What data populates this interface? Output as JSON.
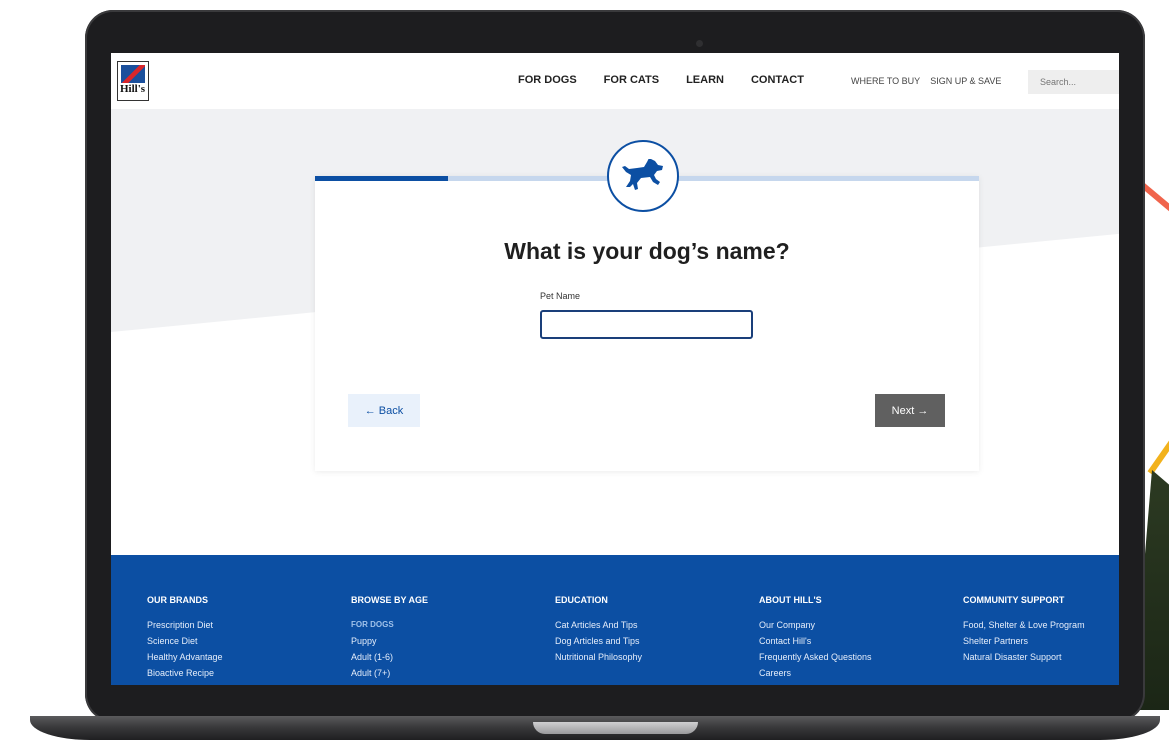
{
  "nav": {
    "logo_text": "Hill's",
    "main": [
      "FOR DOGS",
      "FOR CATS",
      "LEARN",
      "CONTACT"
    ],
    "secondary": [
      "WHERE TO BUY",
      "SIGN UP & SAVE"
    ],
    "search_placeholder": "Search..."
  },
  "quiz": {
    "progress": 0.2,
    "question": "What is your dog’s name?",
    "field_label": "Pet Name",
    "field_value": "",
    "back_label": "← Back",
    "next_label": "Next →"
  },
  "footer": {
    "columns": [
      {
        "heading": "OUR BRANDS",
        "items": [
          "Prescription Diet",
          "Science Diet",
          "Healthy Advantage",
          "Bioactive Recipe"
        ]
      },
      {
        "heading": "BROWSE BY AGE",
        "subheading": "FOR DOGS",
        "items": [
          "Puppy",
          "Adult (1-6)",
          "Adult (7+)"
        ]
      },
      {
        "heading": "EDUCATION",
        "items": [
          "Cat Articles And Tips",
          "Dog Articles and Tips",
          "Nutritional Philosophy"
        ]
      },
      {
        "heading": "ABOUT HILL'S",
        "items": [
          "Our Company",
          "Contact Hill's",
          "Frequently Asked Questions",
          "Careers"
        ]
      },
      {
        "heading": "COMMUNITY SUPPORT",
        "items": [
          "Food, Shelter & Love Program",
          "Shelter Partners",
          "Natural Disaster Support"
        ]
      }
    ]
  },
  "colors": {
    "brand_blue": "#0c4fa3",
    "progress_track": "#c6d7ed",
    "next_button": "#606060"
  }
}
